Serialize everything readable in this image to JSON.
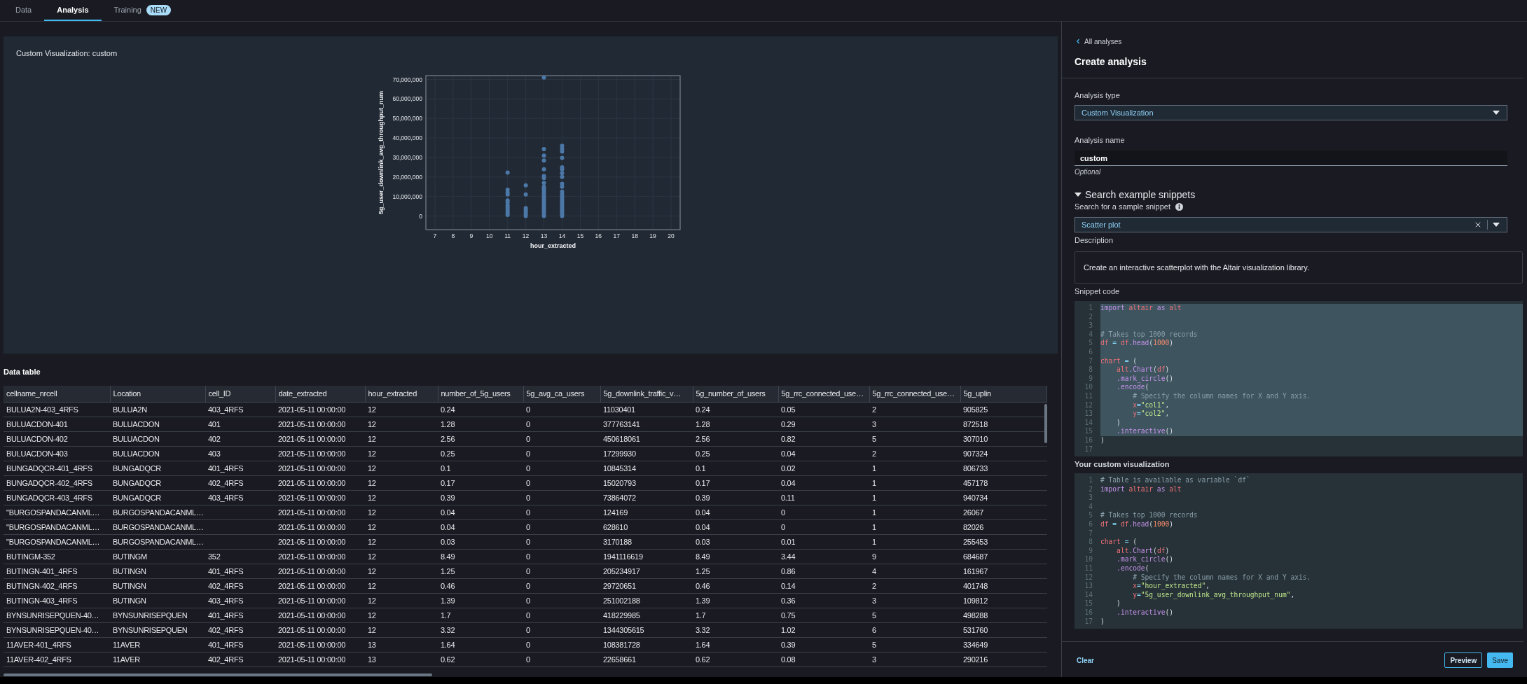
{
  "tabs": [
    {
      "label": "Data",
      "selected": false
    },
    {
      "label": "Analysis",
      "selected": true
    },
    {
      "label": "Training",
      "selected": false,
      "badge": "NEW"
    }
  ],
  "visualization_panel": {
    "title": "Custom Visualization: custom",
    "chart_data": {
      "type": "scatter",
      "grid": true,
      "xlabel": "hour_extracted",
      "ylabel": "5g_user_downlink_avg_throughput_num",
      "xlim": [
        6.5,
        20.5
      ],
      "ylim": [
        -7000000,
        72000000
      ],
      "xticks": [
        7,
        8,
        9,
        10,
        11,
        12,
        13,
        14,
        15,
        16,
        17,
        18,
        19,
        20
      ],
      "yticks": [
        {
          "value": 0,
          "label": "0"
        },
        {
          "value": 10000000,
          "label": "10,000,000"
        },
        {
          "value": 20000000,
          "label": "20,000,000"
        },
        {
          "value": 30000000,
          "label": "30,000,000"
        },
        {
          "value": 40000000,
          "label": "40,000,000"
        },
        {
          "value": 50000000,
          "label": "50,000,000"
        },
        {
          "value": 60000000,
          "label": "60,000,000"
        },
        {
          "value": 70000000,
          "label": "70,000,000"
        }
      ],
      "x": [
        11,
        11,
        11,
        11,
        11,
        11,
        11,
        11,
        11,
        11,
        11,
        11,
        12,
        12,
        12,
        12,
        12,
        12,
        12,
        13,
        13,
        13,
        13,
        13,
        13,
        13,
        13,
        13,
        13,
        13,
        13,
        13,
        13,
        13,
        13,
        13,
        13,
        13,
        13,
        13,
        13,
        13,
        13,
        14,
        14,
        14,
        14,
        14,
        14,
        14,
        14,
        14,
        14,
        14,
        14,
        14,
        14,
        14,
        14,
        14,
        14,
        14,
        14,
        14,
        14,
        14
      ],
      "series": [
        {
          "color": "#4c78a8",
          "values": [
            22300000,
            13500000,
            12000000,
            11000000,
            8000000,
            7000000,
            5500000,
            4500000,
            3500000,
            2500000,
            1500000,
            500000,
            15700000,
            11000000,
            4000000,
            3000000,
            2000000,
            1000000,
            0,
            71000000,
            34300000,
            31000000,
            28500000,
            24000000,
            20500000,
            19500000,
            17000000,
            15000000,
            14000000,
            13000000,
            12000000,
            11000000,
            10000000,
            9000000,
            8000000,
            7000000,
            6000000,
            5000000,
            4000000,
            3000000,
            2000000,
            1000000,
            0,
            36000000,
            34500000,
            33000000,
            29800000,
            25000000,
            24000000,
            22000000,
            20000000,
            16500000,
            15000000,
            12500000,
            11000000,
            10000000,
            9000000,
            8000000,
            7000000,
            6000000,
            5000000,
            4000000,
            3000000,
            2000000,
            1000000,
            0
          ]
        }
      ]
    }
  },
  "data_table": {
    "title": "Data table",
    "columns": [
      "cellname_nrcell",
      "Location",
      "cell_ID",
      "date_extracted",
      "hour_extracted",
      "number_of_5g_users",
      "5g_avg_ca_users",
      "5g_downlink_traffic_v…",
      "5g_number_of_users",
      "5g_rrc_connected_use…",
      "5g_rrc_connected_use…",
      "5g_uplin"
    ],
    "rows": [
      [
        "BULUA2N-403_4RFS",
        "BULUA2N",
        "403_4RFS",
        "2021-05-11 00:00:00",
        "12",
        "0.24",
        "0",
        "11030401",
        "0.24",
        "0.05",
        "2",
        "905825"
      ],
      [
        "BULUACDON-401",
        "BULUACDON",
        "401",
        "2021-05-11 00:00:00",
        "12",
        "1.28",
        "0",
        "377763141",
        "1.28",
        "0.29",
        "3",
        "872518"
      ],
      [
        "BULUACDON-402",
        "BULUACDON",
        "402",
        "2021-05-11 00:00:00",
        "12",
        "2.56",
        "0",
        "450618061",
        "2.56",
        "0.82",
        "5",
        "307010"
      ],
      [
        "BULUACDON-403",
        "BULUACDON",
        "403",
        "2021-05-11 00:00:00",
        "12",
        "0.25",
        "0",
        "17299930",
        "0.25",
        "0.04",
        "2",
        "907324"
      ],
      [
        "BUNGADQCR-401_4RFS",
        "BUNGADQCR",
        "401_4RFS",
        "2021-05-11 00:00:00",
        "12",
        "0.1",
        "0",
        "10845314",
        "0.1",
        "0.02",
        "1",
        "806733"
      ],
      [
        "BUNGADQCR-402_4RFS",
        "BUNGADQCR",
        "402_4RFS",
        "2021-05-11 00:00:00",
        "12",
        "0.17",
        "0",
        "15020793",
        "0.17",
        "0.04",
        "1",
        "457178"
      ],
      [
        "BUNGADQCR-403_4RFS",
        "BUNGADQCR",
        "403_4RFS",
        "2021-05-11 00:00:00",
        "12",
        "0.39",
        "0",
        "73864072",
        "0.39",
        "0.11",
        "1",
        "940734"
      ],
      [
        "\"BURGOSPANDACANML…",
        "BURGOSPANDACANML…",
        null,
        "2021-05-11 00:00:00",
        "12",
        "0.04",
        "0",
        "124169",
        "0.04",
        "0",
        "1",
        "26067"
      ],
      [
        "\"BURGOSPANDACANML…",
        "BURGOSPANDACANML…",
        null,
        "2021-05-11 00:00:00",
        "12",
        "0.04",
        "0",
        "628610",
        "0.04",
        "0",
        "1",
        "82026"
      ],
      [
        "\"BURGOSPANDACANML…",
        "BURGOSPANDACANML…",
        null,
        "2021-05-11 00:00:00",
        "12",
        "0.03",
        "0",
        "3170188",
        "0.03",
        "0.01",
        "1",
        "255453"
      ],
      [
        "BUTINGM-352",
        "BUTINGM",
        "352",
        "2021-05-11 00:00:00",
        "12",
        "8.49",
        "0",
        "1941116619",
        "8.49",
        "3.44",
        "9",
        "684687"
      ],
      [
        "BUTINGN-401_4RFS",
        "BUTINGN",
        "401_4RFS",
        "2021-05-11 00:00:00",
        "12",
        "1.25",
        "0",
        "205234917",
        "1.25",
        "0.86",
        "4",
        "161967"
      ],
      [
        "BUTINGN-402_4RFS",
        "BUTINGN",
        "402_4RFS",
        "2021-05-11 00:00:00",
        "12",
        "0.46",
        "0",
        "29720651",
        "0.46",
        "0.14",
        "2",
        "401748"
      ],
      [
        "BUTINGN-403_4RFS",
        "BUTINGN",
        "403_4RFS",
        "2021-05-11 00:00:00",
        "12",
        "1.39",
        "0",
        "251002188",
        "1.39",
        "0.36",
        "3",
        "109812"
      ],
      [
        "BYNSUNRISEPQUEN-40…",
        "BYNSUNRISEPQUEN",
        "401_4RFS",
        "2021-05-11 00:00:00",
        "12",
        "1.7",
        "0",
        "418229985",
        "1.7",
        "0.75",
        "5",
        "498288"
      ],
      [
        "BYNSUNRISEPQUEN-40…",
        "BYNSUNRISEPQUEN",
        "402_4RFS",
        "2021-05-11 00:00:00",
        "12",
        "3.32",
        "0",
        "1344305615",
        "3.32",
        "1.02",
        "6",
        "531760"
      ],
      [
        "11AVER-401_4RFS",
        "11AVER",
        "401_4RFS",
        "2021-05-11 00:00:00",
        "13",
        "1.64",
        "0",
        "108381728",
        "1.64",
        "0.39",
        "5",
        "334649"
      ],
      [
        "11AVER-402_4RFS",
        "11AVER",
        "402_4RFS",
        "2021-05-11 00:00:00",
        "13",
        "0.62",
        "0",
        "22658661",
        "0.62",
        "0.08",
        "3",
        "290216"
      ]
    ]
  },
  "side_panel": {
    "back_link": "All analyses",
    "title": "Create analysis",
    "analysis_type": {
      "label": "Analysis type",
      "value": "Custom Visualization"
    },
    "analysis_name": {
      "label": "Analysis name",
      "value": "custom",
      "hint": "Optional"
    },
    "snippets": {
      "heading": "Search example snippets",
      "expanded": true,
      "search_label": "Search for a sample snippet",
      "value": "Scatter plot",
      "description_label": "Description",
      "description": "Create an interactive scatterplot with the Altair visualization library.",
      "code_label": "Snippet code",
      "lines": [
        {
          "n": "1",
          "selected": true,
          "tokens": [
            {
              "text": "import",
              "kind": "kw"
            },
            {
              "text": " altair",
              "kind": "var"
            },
            {
              "text": " as",
              "kind": "kw"
            },
            {
              "text": " alt",
              "kind": "var"
            }
          ]
        },
        {
          "n": "2",
          "selected": true
        },
        {
          "n": "3",
          "selected": true
        },
        {
          "n": "4",
          "selected": true,
          "tokens": [
            {
              "text": "# Takes top 1000 records",
              "kind": "cm"
            }
          ]
        },
        {
          "n": "5",
          "selected": true,
          "tokens": [
            {
              "text": "df",
              "kind": "var"
            },
            {
              "text": " = ",
              "kind": "op"
            },
            {
              "text": "df",
              "kind": "var"
            },
            {
              "text": ".head",
              "kind": "fn"
            },
            {
              "text": "(",
              "kind": "p"
            },
            {
              "text": "1000",
              "kind": "num"
            },
            {
              "text": ")",
              "kind": "p"
            }
          ]
        },
        {
          "n": "6",
          "selected": true
        },
        {
          "n": "7",
          "selected": true,
          "tokens": [
            {
              "text": "chart",
              "kind": "var"
            },
            {
              "text": " = ",
              "kind": "op"
            },
            {
              "text": "(",
              "kind": "p"
            }
          ]
        },
        {
          "n": "8",
          "selected": true,
          "tokens": [
            {
              "text": "    alt",
              "kind": "var"
            },
            {
              "text": ".Chart",
              "kind": "fn"
            },
            {
              "text": "(",
              "kind": "p"
            },
            {
              "text": "df",
              "kind": "var"
            },
            {
              "text": ")",
              "kind": "p"
            }
          ]
        },
        {
          "n": "9",
          "selected": true,
          "tokens": [
            {
              "text": "    .mark_circle",
              "kind": "fn"
            },
            {
              "text": "()",
              "kind": "p"
            }
          ]
        },
        {
          "n": "10",
          "selected": true,
          "tokens": [
            {
              "text": "    .encode",
              "kind": "fn"
            },
            {
              "text": "(",
              "kind": "p"
            }
          ]
        },
        {
          "n": "11",
          "selected": true,
          "tokens": [
            {
              "text": "        # Specify the column names for X and Y axis.",
              "kind": "cm"
            }
          ]
        },
        {
          "n": "12",
          "selected": true,
          "tokens": [
            {
              "text": "        x",
              "kind": "var"
            },
            {
              "text": "=",
              "kind": "op"
            },
            {
              "text": "\"col1\"",
              "kind": "str"
            },
            {
              "text": ",",
              "kind": "p"
            }
          ]
        },
        {
          "n": "13",
          "selected": true,
          "tokens": [
            {
              "text": "        y",
              "kind": "var"
            },
            {
              "text": "=",
              "kind": "op"
            },
            {
              "text": "\"col2\"",
              "kind": "str"
            },
            {
              "text": ",",
              "kind": "p"
            }
          ]
        },
        {
          "n": "14",
          "selected": true,
          "tokens": [
            {
              "text": "    )",
              "kind": "p"
            }
          ]
        },
        {
          "n": "15",
          "selected": true,
          "tokens": [
            {
              "text": "    .interactive",
              "kind": "fn"
            },
            {
              "text": "()",
              "kind": "p"
            }
          ]
        },
        {
          "n": "16",
          "selected": false,
          "tokens": [
            {
              "text": ")",
              "kind": "p"
            }
          ]
        },
        {
          "n": "17",
          "selected": false
        }
      ]
    },
    "custom": {
      "label": "Your custom visualization",
      "lines": [
        {
          "n": "1",
          "tokens": [
            {
              "text": "# Table is available as variable `df`",
              "kind": "cm"
            }
          ]
        },
        {
          "n": "2",
          "tokens": [
            {
              "text": "import",
              "kind": "kw"
            },
            {
              "text": " altair",
              "kind": "var"
            },
            {
              "text": " as",
              "kind": "kw"
            },
            {
              "text": " alt",
              "kind": "var"
            }
          ]
        },
        {
          "n": "3"
        },
        {
          "n": "4"
        },
        {
          "n": "5",
          "tokens": [
            {
              "text": "# Takes top 1000 records",
              "kind": "cm"
            }
          ]
        },
        {
          "n": "6",
          "tokens": [
            {
              "text": "df",
              "kind": "var"
            },
            {
              "text": " = ",
              "kind": "op"
            },
            {
              "text": "df",
              "kind": "var"
            },
            {
              "text": ".head",
              "kind": "fn"
            },
            {
              "text": "(",
              "kind": "p"
            },
            {
              "text": "1000",
              "kind": "num"
            },
            {
              "text": ")",
              "kind": "p"
            }
          ]
        },
        {
          "n": "7"
        },
        {
          "n": "8",
          "tokens": [
            {
              "text": "chart",
              "kind": "var"
            },
            {
              "text": " = ",
              "kind": "op"
            },
            {
              "text": "(",
              "kind": "p"
            }
          ]
        },
        {
          "n": "9",
          "tokens": [
            {
              "text": "    alt",
              "kind": "var"
            },
            {
              "text": ".Chart",
              "kind": "fn"
            },
            {
              "text": "(",
              "kind": "p"
            },
            {
              "text": "df",
              "kind": "var"
            },
            {
              "text": ")",
              "kind": "p"
            }
          ]
        },
        {
          "n": "10",
          "tokens": [
            {
              "text": "    .mark_circle",
              "kind": "fn"
            },
            {
              "text": "()",
              "kind": "p"
            }
          ]
        },
        {
          "n": "11",
          "tokens": [
            {
              "text": "    .encode",
              "kind": "fn"
            },
            {
              "text": "(",
              "kind": "p"
            }
          ]
        },
        {
          "n": "12",
          "tokens": [
            {
              "text": "        # Specify the column names for X and Y axis.",
              "kind": "cm"
            }
          ]
        },
        {
          "n": "13",
          "tokens": [
            {
              "text": "        x",
              "kind": "var"
            },
            {
              "text": "=",
              "kind": "op"
            },
            {
              "text": "\"hour_extracted\"",
              "kind": "str"
            },
            {
              "text": ",",
              "kind": "p"
            }
          ]
        },
        {
          "n": "14",
          "tokens": [
            {
              "text": "        y",
              "kind": "var"
            },
            {
              "text": "=",
              "kind": "op"
            },
            {
              "text": "\"5g_user_downlink_avg_throughput_num\"",
              "kind": "str"
            },
            {
              "text": ",",
              "kind": "p"
            }
          ]
        },
        {
          "n": "15",
          "tokens": [
            {
              "text": "    )",
              "kind": "p"
            }
          ]
        },
        {
          "n": "16",
          "tokens": [
            {
              "text": "    .interactive",
              "kind": "fn"
            },
            {
              "text": "()",
              "kind": "p"
            }
          ]
        },
        {
          "n": "17",
          "tokens": [
            {
              "text": ")",
              "kind": "p"
            }
          ]
        }
      ]
    },
    "footer": {
      "clear": "Clear",
      "preview": "Preview",
      "save": "Save"
    }
  }
}
